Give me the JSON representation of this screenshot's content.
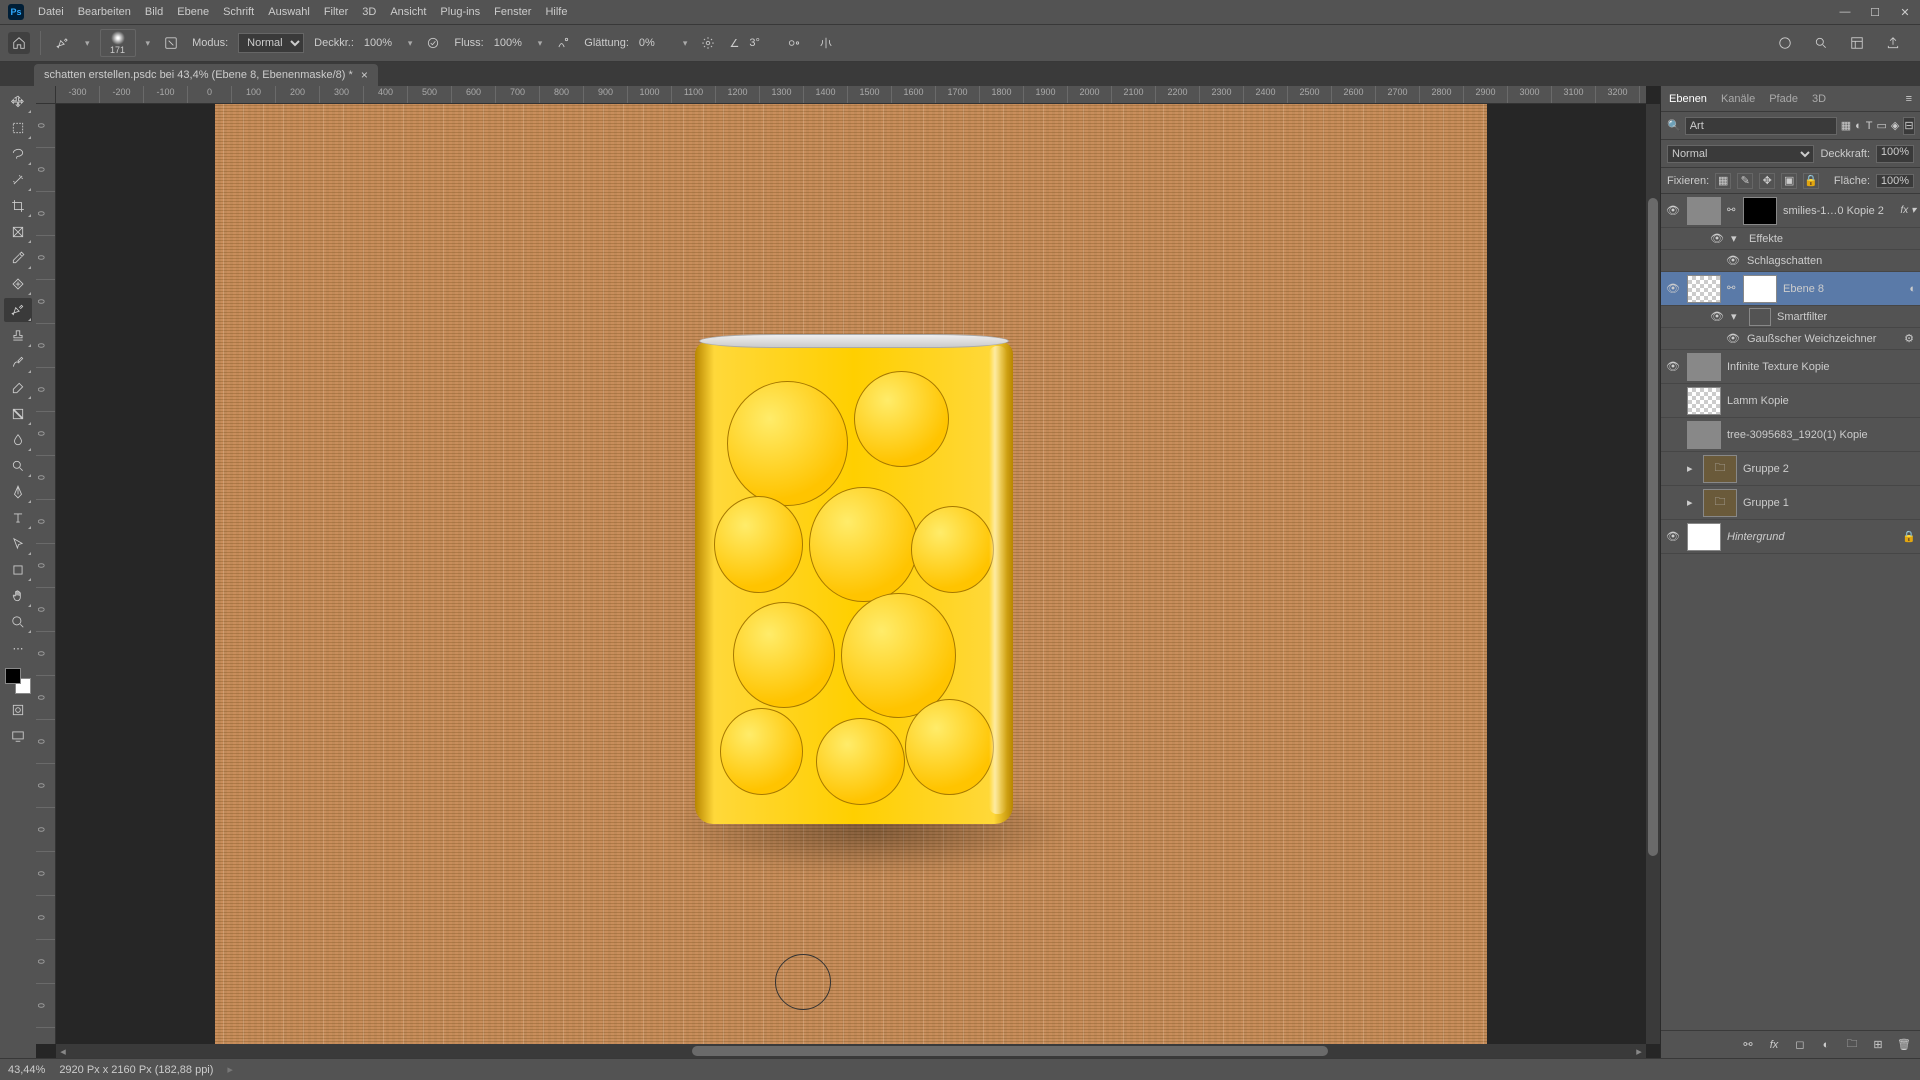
{
  "menu": [
    "Datei",
    "Bearbeiten",
    "Bild",
    "Ebene",
    "Schrift",
    "Auswahl",
    "Filter",
    "3D",
    "Ansicht",
    "Plug-ins",
    "Fenster",
    "Hilfe"
  ],
  "optbar": {
    "brush_size": "171",
    "mode_label": "Modus:",
    "mode_value": "Normal",
    "opacity_label": "Deckkr.:",
    "opacity_value": "100%",
    "flow_label": "Fluss:",
    "flow_value": "100%",
    "smoothing_label": "Glättung:",
    "smoothing_value": "0%",
    "angle_icon": "∠",
    "angle_value": "3°"
  },
  "doc_tab": "schatten erstellen.psdc bei 43,4% (Ebene 8, Ebenenmaske/8) *",
  "ruler_h": [
    "-300",
    "-200",
    "-100",
    "0",
    "100",
    "200",
    "300",
    "400",
    "500",
    "600",
    "700",
    "800",
    "900",
    "1000",
    "1100",
    "1200",
    "1300",
    "1400",
    "1500",
    "1600",
    "1700",
    "1800",
    "1900",
    "2000",
    "2100",
    "2200",
    "2300",
    "2400",
    "2500",
    "2600",
    "2700",
    "2800",
    "2900",
    "3000",
    "3100",
    "3200"
  ],
  "ruler_v": [
    "0",
    "0",
    "0",
    "0",
    "0",
    "0",
    "0",
    "0",
    "0",
    "0",
    "0",
    "0",
    "0",
    "0",
    "0",
    "0",
    "0",
    "0",
    "0",
    "0",
    "0"
  ],
  "panel": {
    "tabs": [
      "Ebenen",
      "Kanäle",
      "Pfade",
      "3D"
    ],
    "search_placeholder": "Art",
    "blend": "Normal",
    "opacity_label": "Deckkraft:",
    "opacity": "100%",
    "lock_label": "Fixieren:",
    "fill_label": "Fläche:",
    "fill": "100%"
  },
  "layers": [
    {
      "vis": true,
      "name": "smilies-1…0 Kopie 2",
      "fx": true,
      "thumb": "img",
      "mask": "black"
    },
    {
      "sub": true,
      "vis": true,
      "name": "Effekte",
      "caret": "▾"
    },
    {
      "sub": true,
      "vis": true,
      "name": "Schlagschatten",
      "indent": true
    },
    {
      "vis": true,
      "name": "Ebene 8",
      "thumb": "chk",
      "mask": "white",
      "sel": true,
      "smart": true
    },
    {
      "sub": true,
      "vis": true,
      "name": "Smartfilter",
      "thumb": "white",
      "caret": "▾"
    },
    {
      "sub": true,
      "vis": true,
      "name": "Gaußscher Weichzeichner",
      "indent": true,
      "gear": true
    },
    {
      "vis": true,
      "name": "Infinite Texture Kopie",
      "thumb": "img"
    },
    {
      "vis": false,
      "name": "Lamm Kopie",
      "thumb": "chk"
    },
    {
      "vis": false,
      "name": "tree-3095683_1920(1) Kopie",
      "thumb": "img"
    },
    {
      "vis": false,
      "name": "Gruppe 2",
      "group": true,
      "caret": "▸"
    },
    {
      "vis": false,
      "name": "Gruppe 1",
      "group": true,
      "caret": "▸"
    },
    {
      "vis": true,
      "name": "Hintergrund",
      "thumb": "white",
      "italic": true,
      "lock": true
    }
  ],
  "status": {
    "zoom": "43,44%",
    "docinfo": "2920 Px x 2160 Px (182,88 ppi)",
    "arrow": "▸"
  }
}
